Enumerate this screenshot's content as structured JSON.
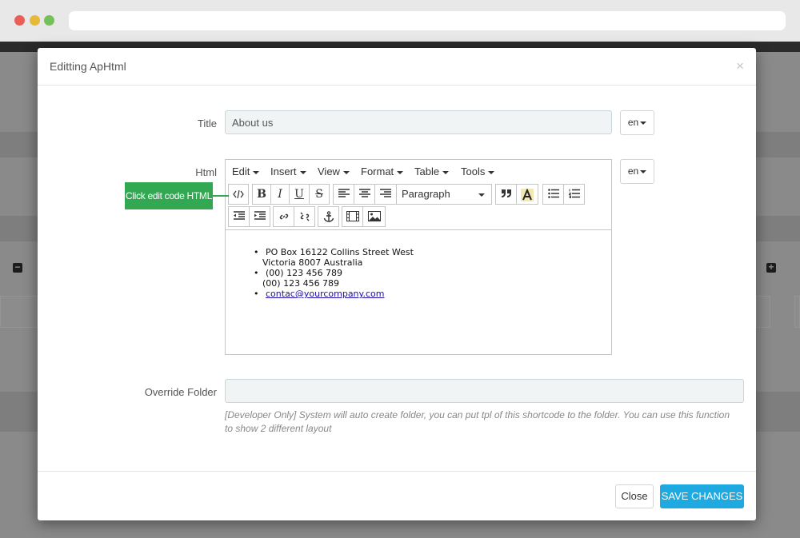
{
  "modal": {
    "title": "Editting ApHtml",
    "close_x": "×"
  },
  "form": {
    "title_label": "Title",
    "title_value": "About us",
    "title_lang": "en",
    "html_label": "Html",
    "html_lang": "en",
    "override_label": "Override Folder",
    "override_value": "",
    "override_help": "[Developer Only] System will auto create folder, you can put tpl of this shortcode to the folder. You can use this function to show 2 different layout"
  },
  "editor": {
    "menus": [
      "Edit",
      "Insert",
      "View",
      "Format",
      "Table",
      "Tools"
    ],
    "format_select": "Paragraph",
    "toolbar_icons": [
      "code-icon",
      "bold-icon",
      "italic-icon",
      "underline-icon",
      "strikethrough-icon",
      "align-left-icon",
      "align-center-icon",
      "align-right-icon",
      "blockquote-icon",
      "text-color-icon",
      "bullet-list-icon",
      "numbered-list-icon",
      "outdent-icon",
      "indent-icon",
      "link-icon",
      "unlink-icon",
      "anchor-icon",
      "media-icon",
      "image-icon"
    ],
    "content": {
      "address_line1": "PO Box 16122 Collins Street West",
      "address_line2": "Victoria 8007 Australia",
      "phone_line1": "(00) 123 456 789",
      "phone_line2": "(00) 123 456 789",
      "email": "contac@yourcompany.com"
    }
  },
  "hint": {
    "label": "Click edit code HTML",
    "color": "#33a852"
  },
  "footer": {
    "close_label": "Close",
    "save_label": "SAVE CHANGES",
    "save_color": "#1fa9e1"
  }
}
